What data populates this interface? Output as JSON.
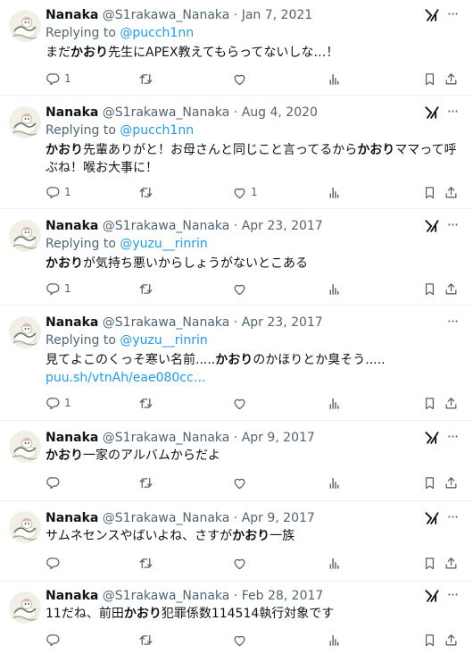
{
  "tweets": [
    {
      "name": "Nanaka",
      "handle": "@S1rakawa_Nanaka",
      "date": "Jan 7, 2021",
      "reply_prefix": "Replying to",
      "reply_handle": "@pucch1nn",
      "segments": [
        {
          "t": "まだ",
          "b": false
        },
        {
          "t": "かおり",
          "b": true
        },
        {
          "t": "先生にAPEX教えてもらってないしな…！",
          "b": false
        }
      ],
      "link": "",
      "reply_count": "1",
      "retweet_count": "",
      "like_count": "",
      "icon": "grok-icon"
    },
    {
      "name": "Nanaka",
      "handle": "@S1rakawa_Nanaka",
      "date": "Aug 4, 2020",
      "reply_prefix": "Replying to",
      "reply_handle": "@pucch1nn",
      "segments": [
        {
          "t": "かおり",
          "b": true
        },
        {
          "t": "先輩ありがと！お母さんと同じこと言ってるから",
          "b": false
        },
        {
          "t": "かおり",
          "b": true
        },
        {
          "t": "ママって呼ぶね！喉お大事に！",
          "b": false
        }
      ],
      "link": "",
      "reply_count": "1",
      "retweet_count": "",
      "like_count": "1",
      "icon": "grok-icon"
    },
    {
      "name": "Nanaka",
      "handle": "@S1rakawa_Nanaka",
      "date": "Apr 23, 2017",
      "reply_prefix": "Replying to",
      "reply_handle": "@yuzu__rinrin",
      "segments": [
        {
          "t": "かおり",
          "b": true
        },
        {
          "t": "が気持ち悪いからしょうがないとこある",
          "b": false
        }
      ],
      "link": "",
      "reply_count": "1",
      "retweet_count": "",
      "like_count": "",
      "icon": "grok-icon"
    },
    {
      "name": "Nanaka",
      "handle": "@S1rakawa_Nanaka",
      "date": "Apr 23, 2017",
      "reply_prefix": "Replying to",
      "reply_handle": "@yuzu__rinrin",
      "segments": [
        {
          "t": "見てよこのくっそ寒い名前.....",
          "b": false
        },
        {
          "t": "かおり",
          "b": true
        },
        {
          "t": "のかほりとか臭そう.....",
          "b": false
        }
      ],
      "link": "puu.sh/vtnAh/eae080cc…",
      "reply_count": "1",
      "retweet_count": "",
      "like_count": "",
      "icon": "none"
    },
    {
      "name": "Nanaka",
      "handle": "@S1rakawa_Nanaka",
      "date": "Apr 9, 2017",
      "reply_prefix": "",
      "reply_handle": "",
      "segments": [
        {
          "t": "かおり",
          "b": true
        },
        {
          "t": "一家のアルバムからだよ",
          "b": false
        }
      ],
      "link": "",
      "reply_count": "",
      "retweet_count": "",
      "like_count": "",
      "icon": "grok-icon"
    },
    {
      "name": "Nanaka",
      "handle": "@S1rakawa_Nanaka",
      "date": "Apr 9, 2017",
      "reply_prefix": "",
      "reply_handle": "",
      "segments": [
        {
          "t": "サムネセンスやばいよね、さすが",
          "b": false
        },
        {
          "t": "かおり",
          "b": true
        },
        {
          "t": "一族",
          "b": false
        }
      ],
      "link": "",
      "reply_count": "",
      "retweet_count": "",
      "like_count": "",
      "icon": "grok-icon"
    },
    {
      "name": "Nanaka",
      "handle": "@S1rakawa_Nanaka",
      "date": "Feb 28, 2017",
      "reply_prefix": "",
      "reply_handle": "",
      "segments": [
        {
          "t": "11だね、前田",
          "b": false
        },
        {
          "t": "かおり",
          "b": true
        },
        {
          "t": "犯罪係数114514執行対象です",
          "b": false
        }
      ],
      "link": "",
      "reply_count": "",
      "retweet_count": "",
      "like_count": "",
      "icon": "grok-icon"
    }
  ],
  "meta_separator": "·",
  "more_glyph": "···",
  "colors": {
    "text": "#0f1419",
    "muted": "#536471",
    "link": "#1d9bf0",
    "divider": "#eff3f4"
  }
}
